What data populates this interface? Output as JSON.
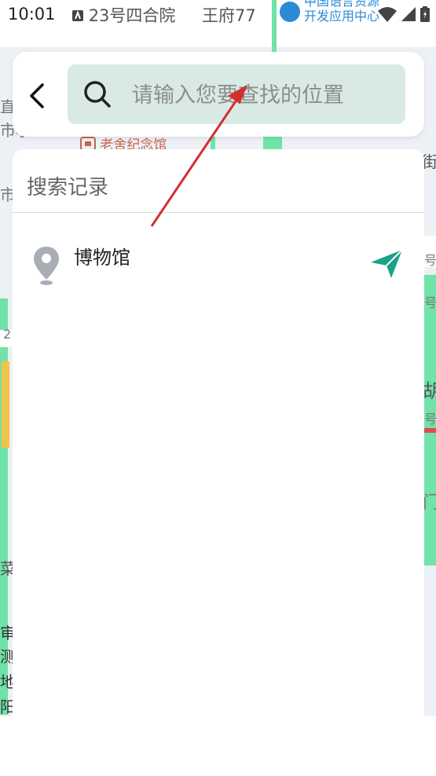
{
  "status_bar": {
    "time": "10:01",
    "location_text": "23号四合院",
    "road_text": "王府77",
    "poi_line1": "中国语言资源",
    "poi_line2": "开发应用中心"
  },
  "search": {
    "placeholder": "请输入您要查找的位置",
    "value": ""
  },
  "map": {
    "poi_label": "老舍纪念馆",
    "edge_labels": [
      "街",
      "号",
      "号",
      "胡",
      "号",
      "门",
      "菜",
      "审",
      "测",
      "地",
      "阳",
      "市",
      "市小",
      "直",
      "2"
    ]
  },
  "history": {
    "title": "搜索记录",
    "items": [
      {
        "label": "博物馆"
      }
    ]
  },
  "colors": {
    "accent": "#1aa186",
    "input_bg": "#d9e9e3",
    "annotation_arrow": "#d32f2f"
  },
  "icons": [
    "back-arrow-icon",
    "search-icon",
    "location-pin-icon",
    "navigate-icon",
    "wifi-icon",
    "signal-icon",
    "battery-icon"
  ]
}
